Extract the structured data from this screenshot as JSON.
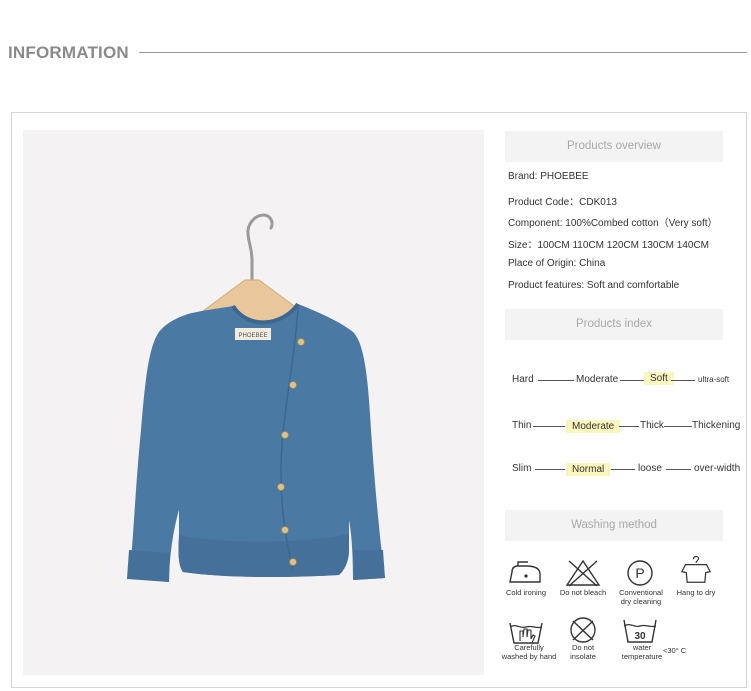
{
  "header": {
    "title": "INFORMATION"
  },
  "photo": {
    "hanger_tag": "PHOEBEE"
  },
  "overview": {
    "title": "Products overview",
    "rows": [
      "Brand:  PHOEBEE",
      "Product Code：CDK013",
      "Component:  100%Combed cotton（Very soft）",
      "Size：100CM  110CM  120CM  130CM  140CM",
      "Place of Origin:  China",
      "Product features:  Soft and comfortable"
    ]
  },
  "index": {
    "title": "Products index",
    "scales": [
      {
        "items": [
          "Hard",
          "Moderate",
          "Soft",
          "ultra-soft"
        ],
        "selected": "Soft"
      },
      {
        "items": [
          "Thin",
          "Moderate",
          "Thick",
          "Thickening"
        ],
        "selected": "Moderate"
      },
      {
        "items": [
          "Slim",
          "Normal",
          "loose",
          "over-width"
        ],
        "selected": "Normal"
      }
    ]
  },
  "washing": {
    "title": "Washing method",
    "items": [
      {
        "icon": "iron-icon",
        "label": "Cold ironing"
      },
      {
        "icon": "no-bleach-icon",
        "label": "Do not bleach"
      },
      {
        "icon": "dry-clean-icon",
        "label": "Conventional\ndry cleaning",
        "symbol": "P"
      },
      {
        "icon": "hang-dry-icon",
        "label": "Hang to dry"
      },
      {
        "icon": "hand-wash-icon",
        "label": "Carefully\nwashed by hand"
      },
      {
        "icon": "no-insolate-icon",
        "label": "Do not\ninsolate"
      },
      {
        "icon": "water-temp-icon",
        "label": "water\ntemperature",
        "symbol": "30"
      }
    ],
    "temperature_note": "<30° C"
  },
  "colors": {
    "accent_highlight": "#fbf6bd",
    "sweater": "#4a7aa4",
    "section_bg": "#f3f3f3"
  }
}
